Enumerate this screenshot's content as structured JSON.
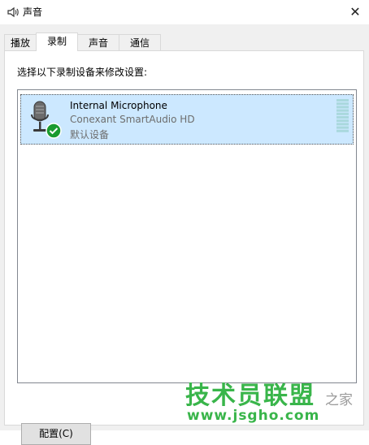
{
  "window": {
    "title": "声音",
    "app_icon": "speaker-icon",
    "close_icon": "close-icon",
    "close_glyph": "✕"
  },
  "tabs": [
    {
      "label": "播放",
      "active": false
    },
    {
      "label": "录制",
      "active": true
    },
    {
      "label": "声音",
      "active": false
    },
    {
      "label": "通信",
      "active": false
    }
  ],
  "recording": {
    "instruction": "选择以下录制设备来修改设置:",
    "devices": [
      {
        "name": "Internal Microphone",
        "driver": "Conexant SmartAudio HD",
        "status": "默认设备",
        "icon": "microphone-icon",
        "status_icon": "green-check-icon",
        "level": 0
      }
    ]
  },
  "buttons": {
    "configure": "配置(C)"
  },
  "watermark": {
    "brand": "技术员联盟",
    "url": "www.jsgho.com",
    "tail": "之家"
  },
  "colors": {
    "selection": "#cce8ff",
    "check": "#1a9b2f",
    "watermark": "#39b54a"
  }
}
